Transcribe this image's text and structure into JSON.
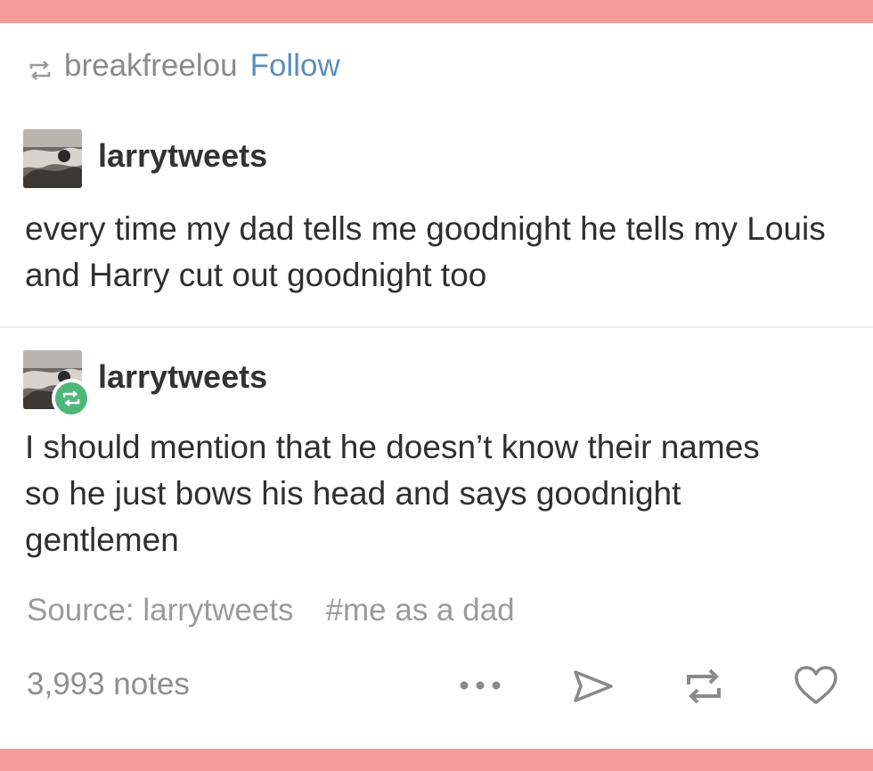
{
  "colors": {
    "band": "#f49b9b",
    "accent_link": "#5b8fb8",
    "reblog_green": "#4fb77a",
    "muted_text": "#9a9a9a"
  },
  "reblog_header": {
    "icon": "reblog-icon",
    "username": "breakfreelou",
    "follow_label": "Follow"
  },
  "posts": [
    {
      "username": "larrytweets",
      "avatar": "avatar-image",
      "text": "every time my dad tells me goodnight he tells my Louis and Harry cut out goodnight too"
    },
    {
      "username": "larrytweets",
      "avatar": "avatar-image",
      "badge_icon": "reblog-badge-icon",
      "text": "I should mention that he doesn’t know their names so he just bows his head and says goodnight gentlemen"
    }
  ],
  "footer": {
    "source_label": "Source: larrytweets",
    "tag": "#me as a dad",
    "notes": "3,993 notes",
    "actions": [
      "more-icon",
      "share-icon",
      "reblog-icon",
      "like-icon"
    ]
  }
}
